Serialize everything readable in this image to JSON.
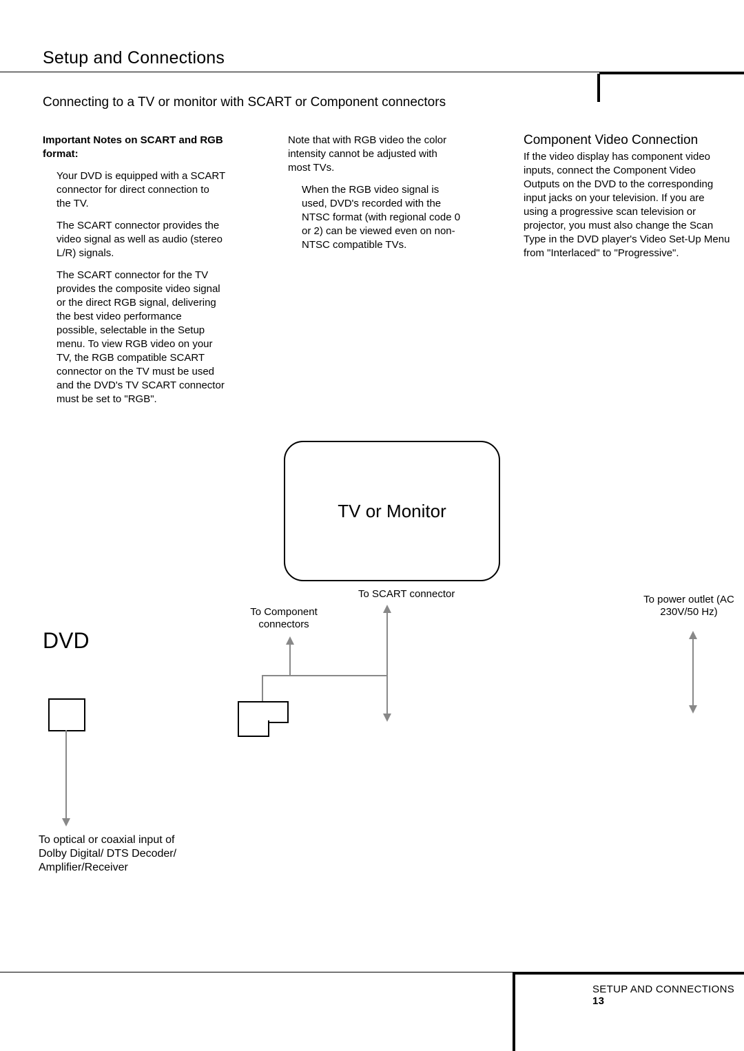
{
  "page_title": "Setup and Connections",
  "section_title": "Connecting to a TV or monitor with SCART or Component connectors",
  "col1": {
    "heading": "Important Notes on SCART and RGB format:",
    "p1": "Your DVD is equipped with a SCART connector for direct connection to the TV.",
    "p2": "The SCART connector provides the video signal as well as audio (stereo L/R) signals.",
    "p3": "The SCART connector for the TV provides the composite video signal or the direct RGB signal, delivering the best video performance possible, selectable in the Setup menu. To view RGB video on your TV, the RGB compatible SCART connector on the TV must be used and the DVD's TV SCART connector must be set to \"RGB\"."
  },
  "col2": {
    "p1": "Note that with RGB video the color intensity cannot be adjusted with most TVs.",
    "p2": "When the RGB video signal is used, DVD's recorded with the NTSC format (with regional code 0 or 2) can be viewed even on non-NTSC compatible TVs."
  },
  "col3": {
    "heading": "Component Video Connection",
    "p1": "If the video display has component video inputs, connect the Component Video Outputs on the DVD to the corresponding input jacks on your television. If you are using a progressive scan television or projector, you must also change the Scan Type in the DVD player's Video Set-Up Menu from \"Interlaced\" to \"Progressive\"."
  },
  "diagram": {
    "dvd_label": "DVD",
    "tv_label": "TV or Monitor",
    "to_scart": "To SCART connector",
    "to_component": "To Component connectors",
    "to_power": "To power outlet (AC 230V/50 Hz)",
    "to_audio": "To optical or coaxial input of Dolby Digital/ DTS Decoder/ Amplifier/Receiver"
  },
  "footer": {
    "section": "SETUP AND CONNECTIONS",
    "page": "13"
  }
}
